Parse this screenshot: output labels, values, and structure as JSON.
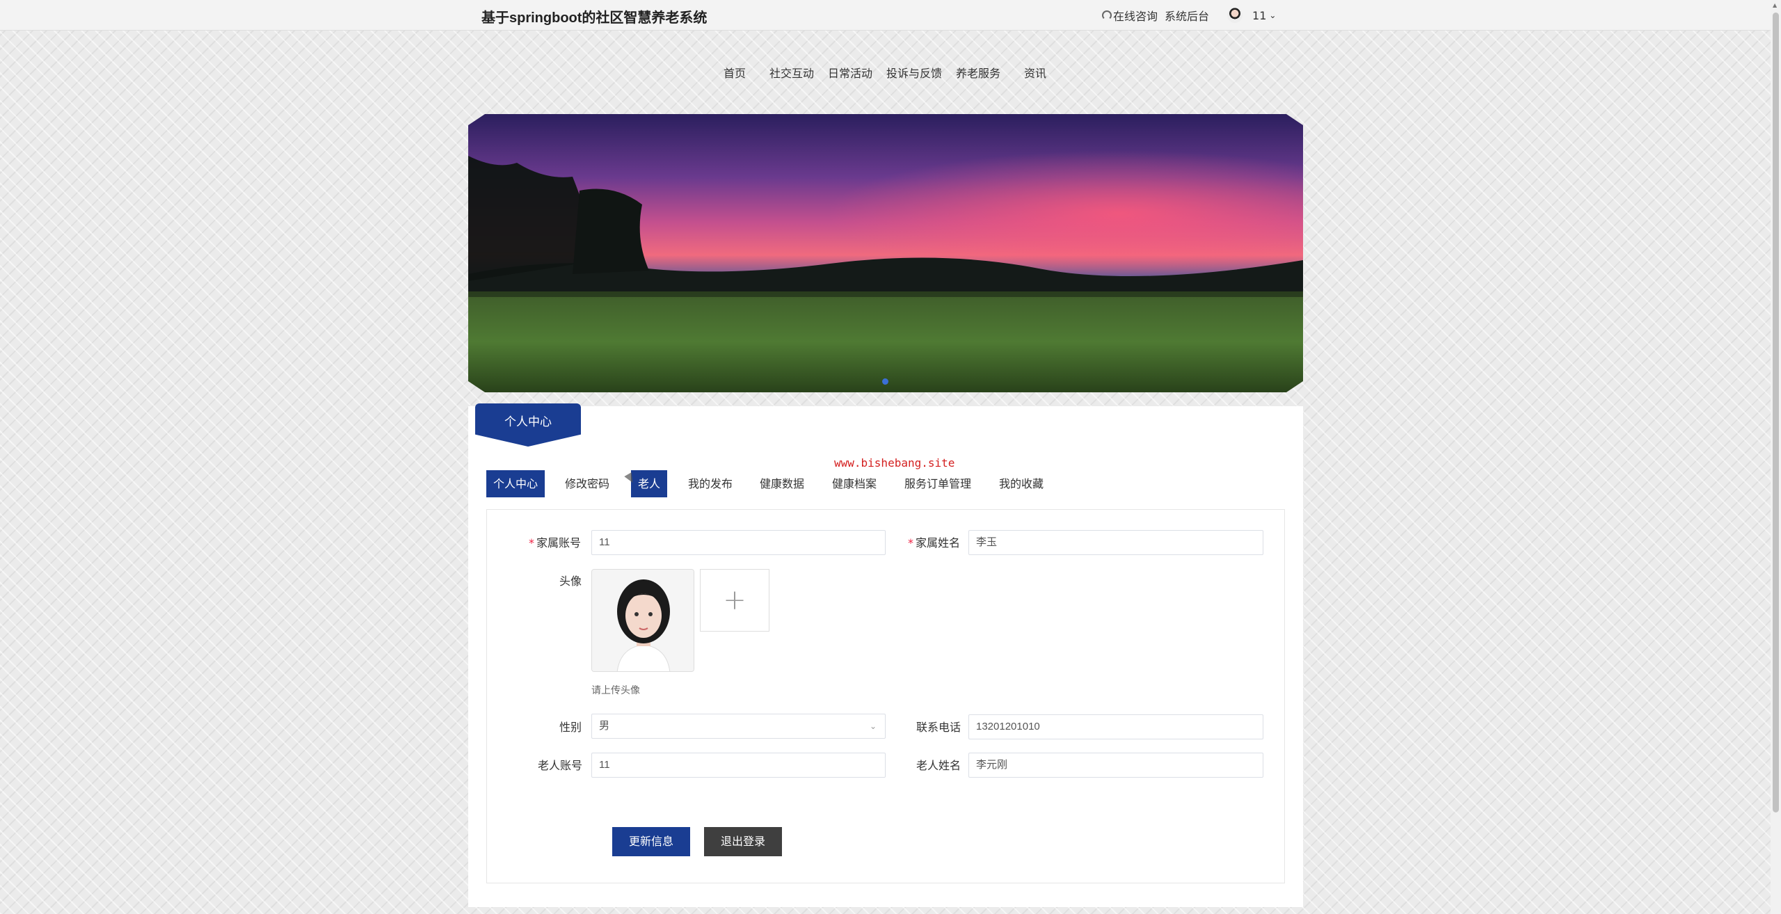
{
  "header": {
    "site_title": "基于springboot的社区智慧养老系统",
    "consult": "在线咨询",
    "admin": "系统后台",
    "user_name": "11"
  },
  "nav": {
    "items": [
      "首页",
      "社交互动",
      "日常活动",
      "投诉与反馈",
      "养老服务",
      "资讯"
    ]
  },
  "panel": {
    "tag": "个人中心",
    "watermark": "www.bishebang.site",
    "tabs": [
      "个人中心",
      "修改密码",
      "老人",
      "我的发布",
      "健康数据",
      "健康档案",
      "服务订单管理",
      "我的收藏"
    ],
    "active_tabs": [
      "个人中心",
      "老人"
    ]
  },
  "form": {
    "family_account_label": "家属账号",
    "family_account": "11",
    "family_name_label": "家属姓名",
    "family_name": "李玉",
    "avatar_label": "头像",
    "avatar_hint": "请上传头像",
    "gender_label": "性别",
    "gender": "男",
    "phone_label": "联系电话",
    "phone": "13201201010",
    "elder_account_label": "老人账号",
    "elder_account": "11",
    "elder_name_label": "老人姓名",
    "elder_name": "李元刚"
  },
  "buttons": {
    "update": "更新信息",
    "logout": "退出登录"
  },
  "colors": {
    "primary": "#1a3d92",
    "dark_button": "#3f3f3f",
    "watermark": "#d42020"
  }
}
